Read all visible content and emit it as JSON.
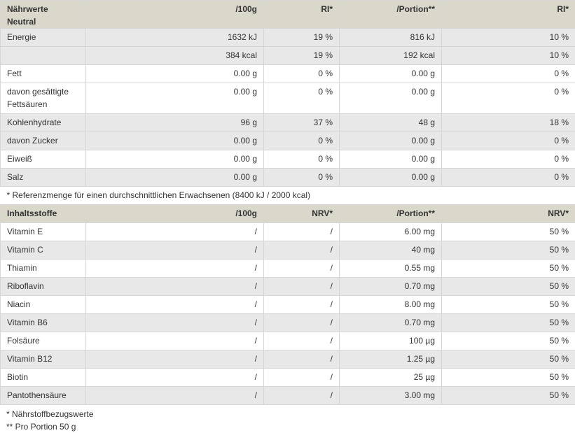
{
  "table1": {
    "header": [
      "Nährwerte Neutral",
      "/100g",
      "RI*",
      "/Portion**",
      "RI*"
    ],
    "rows": [
      [
        "Energie",
        "1632 kJ",
        "19 %",
        "816 kJ",
        "10 %"
      ],
      [
        "",
        "384 kcal",
        "19 %",
        "192 kcal",
        "10 %"
      ],
      [
        "Fett",
        "0.00 g",
        "0 %",
        "0.00 g",
        "0 %"
      ],
      [
        "davon gesättigte Fettsäuren",
        "0.00 g",
        "0 %",
        "0.00 g",
        "0 %"
      ],
      [
        "Kohlenhydrate",
        "96 g",
        "37 %",
        "48 g",
        "18 %"
      ],
      [
        "davon Zucker",
        "0.00 g",
        "0 %",
        "0.00 g",
        "0 %"
      ],
      [
        "Eiweiß",
        "0.00 g",
        "0 %",
        "0.00 g",
        "0 %"
      ],
      [
        "Salz",
        "0.00 g",
        "0 %",
        "0.00 g",
        "0 %"
      ]
    ],
    "note": "* Referenzmenge für einen durchschnittlichen Erwachsenen (8400 kJ / 2000 kcal)"
  },
  "table2": {
    "header": [
      "Inhaltsstoffe",
      "/100g",
      "NRV*",
      "/Portion**",
      "NRV*"
    ],
    "rows": [
      [
        "Vitamin E",
        "/",
        "/",
        "6.00 mg",
        "50 %"
      ],
      [
        "Vitamin C",
        "/",
        "/",
        "40 mg",
        "50 %"
      ],
      [
        "Thiamin",
        "/",
        "/",
        "0.55 mg",
        "50 %"
      ],
      [
        "Riboflavin",
        "/",
        "/",
        "0.70 mg",
        "50 %"
      ],
      [
        "Niacin",
        "/",
        "/",
        "8.00 mg",
        "50 %"
      ],
      [
        "Vitamin B6",
        "/",
        "/",
        "0.70 mg",
        "50 %"
      ],
      [
        "Folsäure",
        "/",
        "/",
        "100 µg",
        "50 %"
      ],
      [
        "Vitamin B12",
        "/",
        "/",
        "1.25 µg",
        "50 %"
      ],
      [
        "Biotin",
        "/",
        "/",
        "25 µg",
        "50 %"
      ],
      [
        "Pantothensäure",
        "/",
        "/",
        "3.00 mg",
        "50 %"
      ]
    ]
  },
  "footnotes": [
    "* Nährstoffbezugswerte",
    "** Pro Portion 50 g"
  ]
}
